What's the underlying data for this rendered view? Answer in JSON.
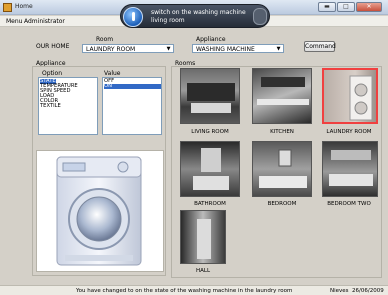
{
  "window": {
    "title": "Home",
    "buttons": {
      "minimize": "▬",
      "maximize": "□",
      "close": "✕"
    }
  },
  "menu": {
    "items": [
      "Menu",
      "Administrator"
    ]
  },
  "notification": {
    "line1": "switch on the washing machine",
    "line2": "living room"
  },
  "home_label": "OUR HOME",
  "room_select": {
    "label": "Room",
    "value": "LAUNDRY ROOM"
  },
  "appliance_select": {
    "label": "Appliance",
    "value": "WASHING MACHINE"
  },
  "command_button": "Command",
  "appliance_panel": {
    "title": "Appliance",
    "option_header": "Option",
    "value_header": "Value",
    "options": [
      "STATE",
      "TEMPERATURE",
      "SPIN SPEED",
      "LOAD",
      "COLOR",
      "TEXTILE"
    ],
    "values": [
      "OFF",
      "ON"
    ],
    "selected_option": "STATE",
    "selected_value": "ON"
  },
  "rooms_panel": {
    "title": "Rooms",
    "rooms": [
      {
        "name": "LIVING ROOM"
      },
      {
        "name": "KITCHEN"
      },
      {
        "name": "LAUNDRY ROOM",
        "selected": true
      },
      {
        "name": "BATHROOM"
      },
      {
        "name": "BEDROOM"
      },
      {
        "name": "BEDROOM TWO"
      },
      {
        "name": "HALL"
      }
    ]
  },
  "status": {
    "message": "You have changed to on the state of the washing machine in the laundry room",
    "user": "Nieves",
    "date": "26/06/2009"
  }
}
